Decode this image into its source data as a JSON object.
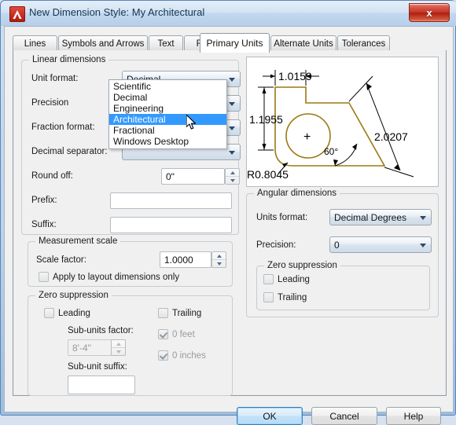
{
  "window": {
    "title": "New Dimension Style: My Architectural",
    "app_icon": "autocad-a-icon",
    "close_label": "x"
  },
  "tabs": [
    {
      "label": "Lines",
      "active": false
    },
    {
      "label": "Symbols and Arrows",
      "active": false
    },
    {
      "label": "Text",
      "active": false
    },
    {
      "label": "Fit",
      "active": false
    },
    {
      "label": "Primary Units",
      "active": true
    },
    {
      "label": "Alternate Units",
      "active": false
    },
    {
      "label": "Tolerances",
      "active": false
    }
  ],
  "linear": {
    "group_title": "Linear dimensions",
    "unit_format_label": "Unit format:",
    "unit_format_value": "Decimal",
    "unit_format_options": [
      "Scientific",
      "Decimal",
      "Engineering",
      "Architectural",
      "Fractional",
      "Windows Desktop"
    ],
    "unit_format_highlighted": "Architectural",
    "precision_label": "Precision",
    "fraction_format_label": "Fraction format:",
    "decimal_separator_label": "Decimal separator:",
    "round_off_label": "Round off:",
    "round_off_value": "0\"",
    "prefix_label": "Prefix:",
    "prefix_value": "",
    "suffix_label": "Suffix:",
    "suffix_value": ""
  },
  "measurement_scale": {
    "group_title": "Measurement scale",
    "scale_factor_label": "Scale factor:",
    "scale_factor_value": "1.0000",
    "apply_layout_label": "Apply to layout dimensions only",
    "apply_layout_checked": false
  },
  "zero_suppression_linear": {
    "group_title": "Zero suppression",
    "leading_label": "Leading",
    "leading_checked": false,
    "trailing_label": "Trailing",
    "trailing_checked": false,
    "sub_units_factor_label": "Sub-units factor:",
    "sub_units_factor_value": "8'-4\"",
    "sub_unit_suffix_label": "Sub-unit suffix:",
    "sub_unit_suffix_value": "",
    "zero_feet_label": "0 feet",
    "zero_feet_checked": true,
    "zero_inches_label": "0 inches",
    "zero_inches_checked": true
  },
  "angular": {
    "group_title": "Angular dimensions",
    "units_format_label": "Units format:",
    "units_format_value": "Decimal Degrees",
    "precision_label": "Precision:",
    "precision_value": "0",
    "zero_suppression_title": "Zero suppression",
    "leading_label": "Leading",
    "leading_checked": false,
    "trailing_label": "Trailing",
    "trailing_checked": false
  },
  "preview": {
    "name": "dimension-style-preview",
    "line_color": "#9a7a12",
    "dim_color": "#000000",
    "labels": {
      "top": "1.0159",
      "left": "1.1955",
      "diagonal": "2.0207",
      "angle": "60°",
      "radius": "R0.8045"
    }
  },
  "buttons": {
    "ok": "OK",
    "cancel": "Cancel",
    "help": "Help"
  }
}
